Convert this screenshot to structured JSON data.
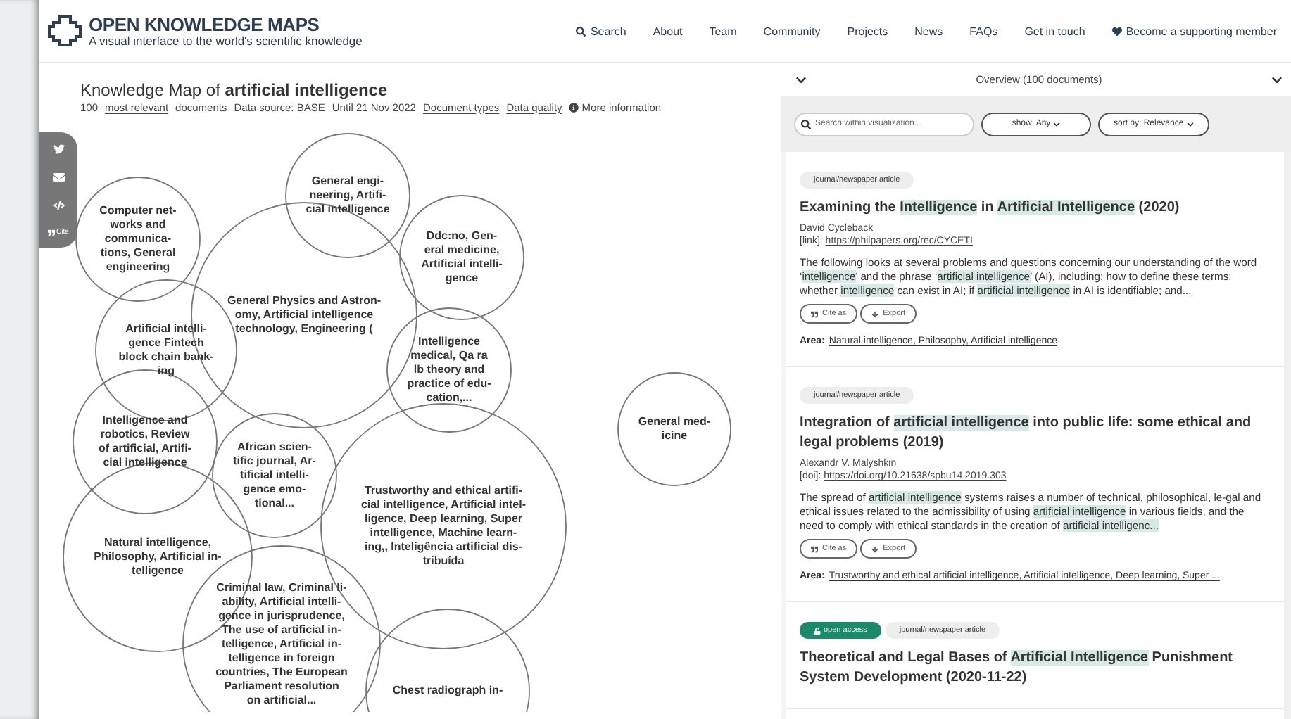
{
  "header": {
    "brand": "OPEN KNOWLEDGE MAPS",
    "tagline": "A visual interface to the world's scientific knowledge",
    "nav": [
      {
        "kind": "search",
        "label": "Search"
      },
      {
        "kind": "plain",
        "label": "About"
      },
      {
        "kind": "plain",
        "label": "Team"
      },
      {
        "kind": "plain",
        "label": "Community"
      },
      {
        "kind": "plain",
        "label": "Projects"
      },
      {
        "kind": "plain",
        "label": "News"
      },
      {
        "kind": "plain",
        "label": "FAQs"
      },
      {
        "kind": "plain",
        "label": "Get in touch"
      },
      {
        "kind": "heart",
        "label": "Become a supporting member"
      }
    ]
  },
  "map_header": {
    "title_prefix": "Knowledge Map of",
    "query": "artificial intelligence",
    "meta": [
      {
        "kind": "text",
        "label": "100"
      },
      {
        "kind": "link",
        "label": "most relevant"
      },
      {
        "kind": "text",
        "label": "documents"
      },
      {
        "kind": "text",
        "label": "Data source: BASE"
      },
      {
        "kind": "text",
        "label": "Until 21 Nov 2022"
      },
      {
        "kind": "link",
        "label": "Document types"
      },
      {
        "kind": "link",
        "label": "Data quality"
      },
      {
        "kind": "info",
        "label": "More information"
      }
    ]
  },
  "share_bar": [
    {
      "kind": "twitter"
    },
    {
      "kind": "mail"
    },
    {
      "kind": "embed"
    },
    {
      "kind": "cite",
      "label": "Cite"
    }
  ],
  "bubbles": [
    {
      "lines": [
        "General Physics and Astron-",
        "omy, Artificial intelligence",
        "technology, Engineering ("
      ]
    },
    {
      "lines": [
        "Computer net-",
        "works and",
        "communica-",
        "tions, General",
        "engineering"
      ]
    },
    {
      "lines": [
        "General engi-",
        "neering, Artifi-",
        "cial intelligence"
      ]
    },
    {
      "lines": [
        "Ddc:no, Gen-",
        "eral medicine,",
        "Artificial intelli-",
        "gence"
      ]
    },
    {
      "lines": [
        "Artificial intelli-",
        "gence Fintech",
        "block chain bank-",
        "ing"
      ]
    },
    {
      "lines": [
        "Intelligence",
        "medical, Qa ra",
        "lb theory and",
        "practice of edu-",
        "cation,..."
      ]
    },
    {
      "lines": [
        "Intelligence and",
        "robotics, Review",
        "of artificial, Artifi-",
        "cial intelligence"
      ]
    },
    {
      "lines": [
        "Natural intelligence,",
        "Philosophy, Artificial in-",
        "telligence"
      ]
    },
    {
      "lines": [
        "African scien-",
        "tific journal, Ar-",
        "tificial intelli-",
        "gence emo-",
        "tional..."
      ]
    },
    {
      "lines": [
        "Trustworthy and ethical artifi-",
        "cial intelligence, Artificial intel-",
        "ligence, Deep learning, Super",
        "intelligence, Machine learn-",
        "ing,, Inteligência artificial dis-",
        "tribuída"
      ]
    },
    {
      "lines": [
        "Criminal law, Criminal li-",
        "ability, Artificial intelli-",
        "gence in jurisprudence,",
        "The use of artificial in-",
        "telligence, Artificial in-",
        "telligence in foreign",
        "countries, The European",
        "Parliament resolution",
        "on artificial..."
      ]
    },
    {
      "lines": [
        "Chest radiograph in-"
      ]
    },
    {
      "lines": [
        "General med-",
        "icine"
      ]
    }
  ],
  "list_panel": {
    "overview": "Overview (100 documents)",
    "search": {
      "placeholder": "Search within visualization..."
    },
    "filters": [
      "show: Any",
      "sort by: Relevance"
    ],
    "documents": [
      {
        "tags": [
          {
            "kind": "type",
            "label": "journal/newspaper article"
          }
        ],
        "title": [
          {
            "t": "Examining the ",
            "hl": false
          },
          {
            "t": "Intelligence",
            "hl": true
          },
          {
            "t": " in ",
            "hl": false
          },
          {
            "t": "Artificial Intelligence",
            "hl": true
          },
          {
            "t": " (2020)",
            "hl": false
          }
        ],
        "authors": "David Cycleback",
        "link_label": "[link]:",
        "link": "https://philpapers.org/rec/CYCETI",
        "abstract": [
          {
            "t": "The following looks at several problems and questions concerning our understanding of the word ‘",
            "hl": false
          },
          {
            "t": "intelligence",
            "hl": true
          },
          {
            "t": "’ and the phrase ‘",
            "hl": false
          },
          {
            "t": "artificial intelligence",
            "hl": true
          },
          {
            "t": "’ (AI), including: how to define these terms; whether ",
            "hl": false
          },
          {
            "t": "intelligence",
            "hl": true
          },
          {
            "t": " can exist in AI; if ",
            "hl": false
          },
          {
            "t": "artificial intelligence",
            "hl": true
          },
          {
            "t": " in AI is identifiable; and...",
            "hl": false
          }
        ],
        "actions": [
          {
            "kind": "cite",
            "label": "Cite as"
          },
          {
            "kind": "export",
            "label": "Export"
          }
        ],
        "area_label": "Area:",
        "area": "Natural intelligence, Philosophy, Artificial intelligence"
      },
      {
        "tags": [
          {
            "kind": "type",
            "label": "journal/newspaper article"
          }
        ],
        "title": [
          {
            "t": "Integration of ",
            "hl": false
          },
          {
            "t": "artificial intelligence",
            "hl": true
          },
          {
            "t": " into public life: some ethical and legal problems (2019)",
            "hl": false
          }
        ],
        "authors": "Alexandr V. Malyshkin",
        "link_label": "[doi]:",
        "link": "https://doi.org/10.21638/spbu14.2019.303",
        "abstract": [
          {
            "t": "The spread of ",
            "hl": false
          },
          {
            "t": "artificial intelligence",
            "hl": true
          },
          {
            "t": " systems raises a number of technical, philosophical, le-gal and ethical issues related to the admissibility of using ",
            "hl": false
          },
          {
            "t": "artificial intelligence",
            "hl": true
          },
          {
            "t": " in various fields, and the need to comply with ethical standards in the creation of ",
            "hl": false
          },
          {
            "t": "artificial intelligenc...",
            "hl": true
          }
        ],
        "actions": [
          {
            "kind": "cite",
            "label": "Cite as"
          },
          {
            "kind": "export",
            "label": "Export"
          }
        ],
        "area_label": "Area:",
        "area": "Trustworthy and ethical artificial intelligence, Artificial intelligence, Deep learning, Super ..."
      },
      {
        "tags": [
          {
            "kind": "open_access",
            "label": "open access"
          },
          {
            "kind": "type",
            "label": "journal/newspaper article"
          }
        ],
        "title": [
          {
            "t": "Theoretical and Legal Bases of ",
            "hl": false
          },
          {
            "t": "Artificial Intelligence",
            "hl": true
          },
          {
            "t": " Punishment System Development (2020-11-22)",
            "hl": false
          }
        ]
      }
    ]
  }
}
